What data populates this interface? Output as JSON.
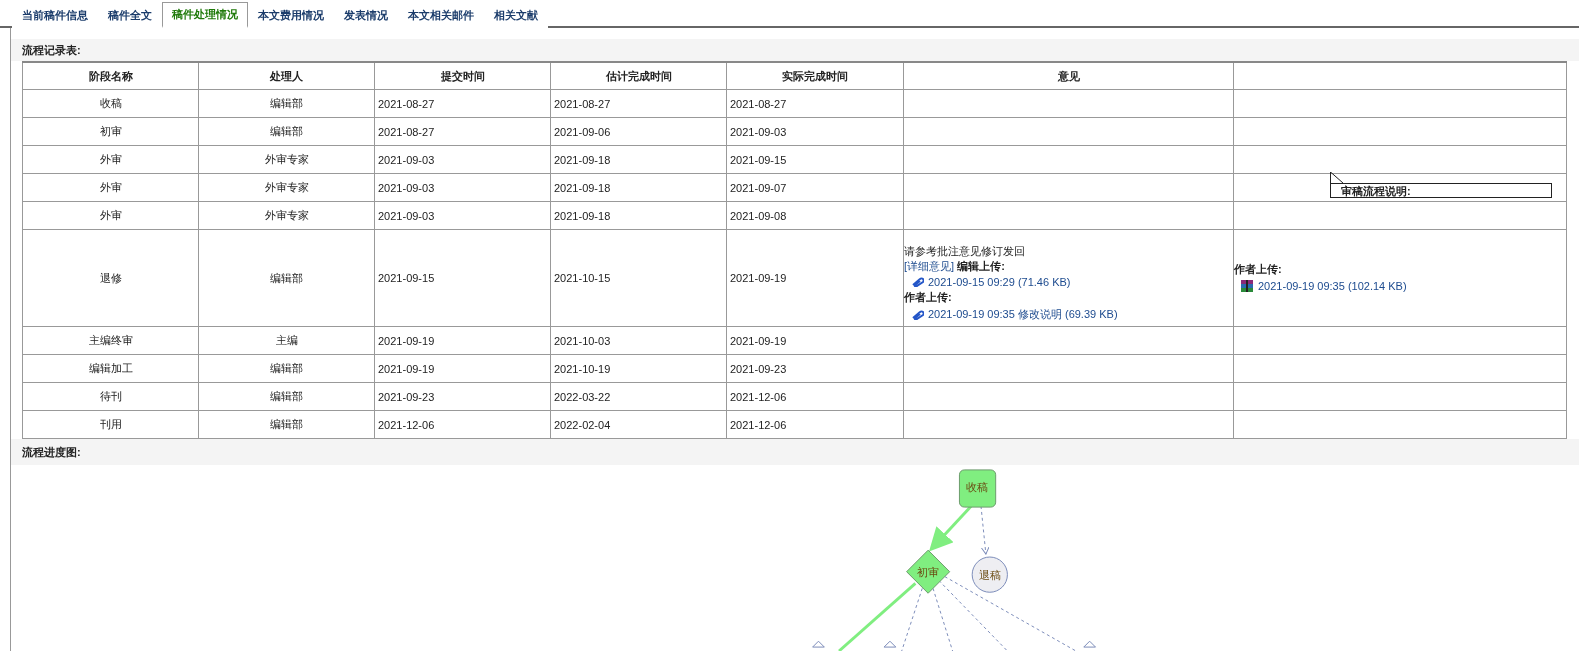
{
  "tabs": [
    {
      "label": "当前稿件信息",
      "selected": false
    },
    {
      "label": "稿件全文",
      "selected": false
    },
    {
      "label": "稿件处理情况",
      "selected": true
    },
    {
      "label": "本文费用情况",
      "selected": false
    },
    {
      "label": "发表情况",
      "selected": false
    },
    {
      "label": "本文相关邮件",
      "selected": false
    },
    {
      "label": "相关文献",
      "selected": false
    }
  ],
  "record_section": {
    "title": "流程记录表:"
  },
  "table": {
    "columns": [
      "阶段名称",
      "处理人",
      "提交时间",
      "估计完成时间",
      "实际完成时间",
      "意见"
    ],
    "rows": [
      {
        "stage": "收稿",
        "handler": "编辑部",
        "submitted": "2021-08-27",
        "estimated": "2021-08-27",
        "actual": "2021-08-27"
      },
      {
        "stage": "初审",
        "handler": "编辑部",
        "submitted": "2021-08-27",
        "estimated": "2021-09-06",
        "actual": "2021-09-03"
      },
      {
        "stage": "外审",
        "handler": "外审专家",
        "submitted": "2021-09-03",
        "estimated": "2021-09-18",
        "actual": "2021-09-15"
      },
      {
        "stage": "外审",
        "handler": "外审专家",
        "submitted": "2021-09-03",
        "estimated": "2021-09-18",
        "actual": "2021-09-07"
      },
      {
        "stage": "外审",
        "handler": "外审专家",
        "submitted": "2021-09-03",
        "estimated": "2021-09-18",
        "actual": "2021-09-08"
      },
      {
        "stage": "退修",
        "handler": "编辑部",
        "submitted": "2021-09-15",
        "estimated": "2021-10-15",
        "actual": "2021-09-19",
        "opinion": {
          "text": "请参考批注意见修订发回",
          "detail_link": "[详细意见]",
          "editor_label": "编辑上传:",
          "editor_files": [
            {
              "kind": "clip",
              "text": "2021-09-15 09:29 (71.46 KB)"
            }
          ],
          "author_label": "作者上传:",
          "author_files": [
            {
              "kind": "clip",
              "text": "2021-09-19 09:35 修改说明 (69.39 KB)"
            }
          ]
        },
        "column_7": {
          "label": "作者上传:",
          "files": [
            {
              "kind": "archive",
              "text": "2021-09-19 09:35 (102.14 KB)"
            }
          ]
        }
      },
      {
        "stage": "主编终审",
        "handler": "主编",
        "submitted": "2021-09-19",
        "estimated": "2021-10-03",
        "actual": "2021-09-19"
      },
      {
        "stage": "编辑加工",
        "handler": "编辑部",
        "submitted": "2021-09-19",
        "estimated": "2021-10-19",
        "actual": "2021-09-23"
      },
      {
        "stage": "待刊",
        "handler": "编辑部",
        "submitted": "2021-09-23",
        "estimated": "2022-03-22",
        "actual": "2021-12-06"
      },
      {
        "stage": "刊用",
        "handler": "编辑部",
        "submitted": "2021-12-06",
        "estimated": "2022-02-04",
        "actual": "2021-12-06"
      }
    ]
  },
  "tooltip": {
    "text": "审稿流程说明:"
  },
  "progress_section": {
    "title": "流程进度图:"
  },
  "flow_nodes": [
    {
      "label": "收稿",
      "kind": "rect",
      "color": "#80ee80"
    },
    {
      "label": "初审",
      "kind": "diamond",
      "color": "#80ee80"
    },
    {
      "label": "退稿",
      "kind": "circle",
      "color": "#eeeef2"
    }
  ]
}
